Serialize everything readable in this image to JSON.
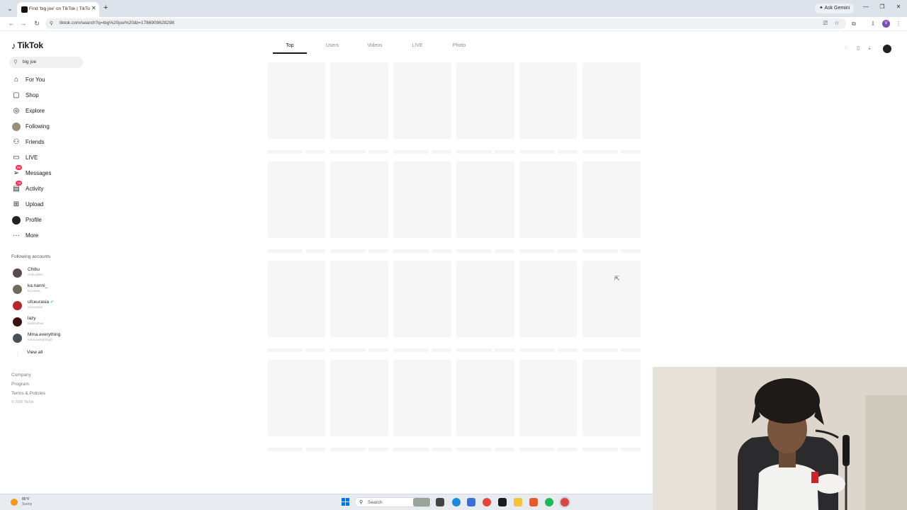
{
  "browser": {
    "tab_title": "Find 'big joe' on TikTok | TikTok",
    "url": "tiktok.com/search?q=big%20joe%20&t=1786909628298",
    "ask_gemini": "Ask Gemini",
    "profile_initial": "V"
  },
  "tiktok": {
    "logo_text": "TikTok",
    "search_value": "big joe",
    "nav": [
      {
        "label": "For You"
      },
      {
        "label": "Shop"
      },
      {
        "label": "Explore"
      },
      {
        "label": "Following"
      },
      {
        "label": "Friends"
      },
      {
        "label": "LIVE"
      },
      {
        "label": "Messages",
        "badge": "99"
      },
      {
        "label": "Activity",
        "badge": "78"
      },
      {
        "label": "Upload"
      },
      {
        "label": "Profile"
      },
      {
        "label": "More"
      }
    ],
    "following_header": "Following accounts",
    "accounts": [
      {
        "name": "Chibu",
        "handle": "chibuchibu"
      },
      {
        "name": "ka.nanni_",
        "handle": "ka.nanni_"
      },
      {
        "name": "ufceurasia",
        "handle": "ufceurasia",
        "verified": true
      },
      {
        "name": "lazy",
        "handle": "lamlimilhan"
      },
      {
        "name": "Mma.everything",
        "handle": "mma.everything0"
      }
    ],
    "view_all": "View all",
    "footer": [
      "Company",
      "Program",
      "Terms & Policies"
    ],
    "copyright": "© 2026 TikTok",
    "tabs": [
      "Top",
      "Users",
      "Videos",
      "LIVE",
      "Photo"
    ],
    "active_tab": "Top"
  },
  "taskbar": {
    "weather_temp": "86°F",
    "weather_desc": "Sunny",
    "search_label": "Search"
  },
  "colors": {
    "accent": "#fe2c55",
    "text": "#161823",
    "skeleton": "#f6f6f7"
  }
}
